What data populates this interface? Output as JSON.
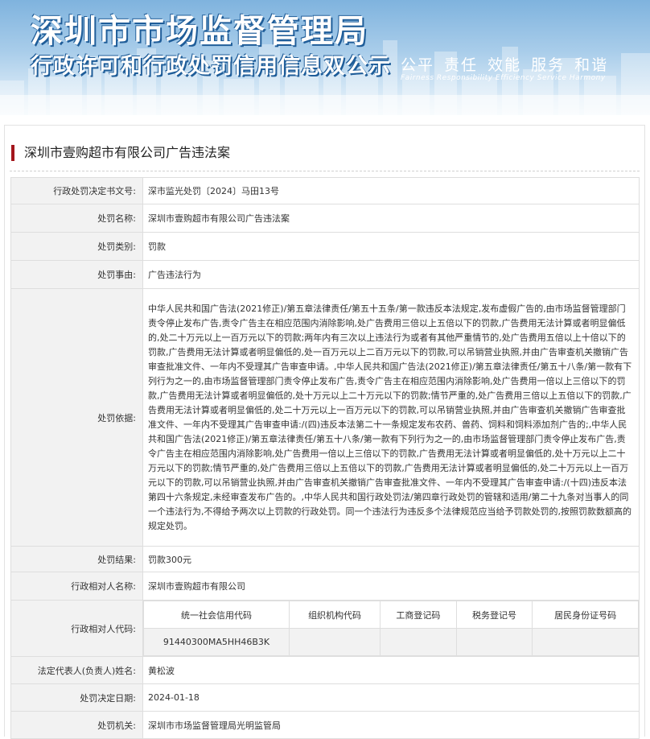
{
  "banner": {
    "title": "深圳市市场监督管理局",
    "subtitle": "行政许可和行政处罚信用信息双公示",
    "slogan": "公平 责任 效能 服务 和谐",
    "slogan_en": "Fairness Responsibility Efficiency Service Harmony"
  },
  "case": {
    "title": "深圳市壹购超市有限公司广告违法案"
  },
  "fields": {
    "doc_no": {
      "label": "行政处罚决定书文号:",
      "value": "深市监光处罚〔2024〕马田13号"
    },
    "name": {
      "label": "处罚名称:",
      "value": "深圳市壹购超市有限公司广告违法案"
    },
    "type": {
      "label": "处罚类别:",
      "value": "罚款"
    },
    "reason": {
      "label": "处罚事由:",
      "value": "广告违法行为"
    },
    "basis": {
      "label": "处罚依据:",
      "value": "中华人民共和国广告法(2021修正)/第五章法律责任/第五十五条/第一款违反本法规定,发布虚假广告的,由市场监督管理部门责令停止发布广告,责令广告主在相应范围内消除影响,处广告费用三倍以上五倍以下的罚款,广告费用无法计算或者明显偏低的,处二十万元以上一百万元以下的罚款;两年内有三次以上违法行为或者有其他严重情节的,处广告费用五倍以上十倍以下的罚款,广告费用无法计算或者明显偏低的,处一百万元以上二百万元以下的罚款,可以吊销营业执照,并由广告审查机关撤销广告审查批准文件、一年内不受理其广告审查申请。,中华人民共和国广告法(2021修正)/第五章法律责任/第五十八条/第一款有下列行为之一的,由市场监督管理部门责令停止发布广告,责令广告主在相应范围内消除影响,处广告费用一倍以上三倍以下的罚款,广告费用无法计算或者明显偏低的,处十万元以上二十万元以下的罚款;情节严重的,处广告费用三倍以上五倍以下的罚款,广告费用无法计算或者明显偏低的,处二十万元以上一百万元以下的罚款,可以吊销营业执照,并由广告审查机关撤销广告审查批准文件、一年内不受理其广告审查申请:/(四)违反本法第二十一条规定发布农药、兽药、饲料和饲料添加剂广告的;,中华人民共和国广告法(2021修正)/第五章法律责任/第五十八条/第一款有下列行为之一的,由市场监督管理部门责令停止发布广告,责令广告主在相应范围内消除影响,处广告费用一倍以上三倍以下的罚款,广告费用无法计算或者明显偏低的,处十万元以上二十万元以下的罚款;情节严重的,处广告费用三倍以上五倍以下的罚款,广告费用无法计算或者明显偏低的,处二十万元以上一百万元以下的罚款,可以吊销营业执照,并由广告审查机关撤销广告审查批准文件、一年内不受理其广告审查申请:/(十四)违反本法第四十六条规定,未经审查发布广告的。,中华人民共和国行政处罚法/第四章行政处罚的管辖和适用/第二十九条对当事人的同一个违法行为,不得给予两次以上罚款的行政处罚。同一个违法行为违反多个法律规范应当给予罚款处罚的,按照罚款数额高的规定处罚。"
    },
    "result": {
      "label": "处罚结果:",
      "value": "罚款300元"
    },
    "party_name": {
      "label": "行政相对人名称:",
      "value": "深圳市壹购超市有限公司"
    },
    "party_code": {
      "label": "行政相对人代码:",
      "headers": [
        "统一社会信用代码",
        "组织机构代码",
        "工商登记码",
        "税务登记号",
        "居民身份证号码"
      ],
      "values": [
        "91440300MA5HH46B3K",
        "",
        "",
        "",
        ""
      ]
    },
    "legal_rep": {
      "label": "法定代表人(负责人)姓名:",
      "value": "黄松波"
    },
    "date": {
      "label": "处罚决定日期:",
      "value": "2024-01-18"
    },
    "authority": {
      "label": "处罚机关:",
      "value": "深圳市市场监督管理局光明监管局"
    }
  }
}
